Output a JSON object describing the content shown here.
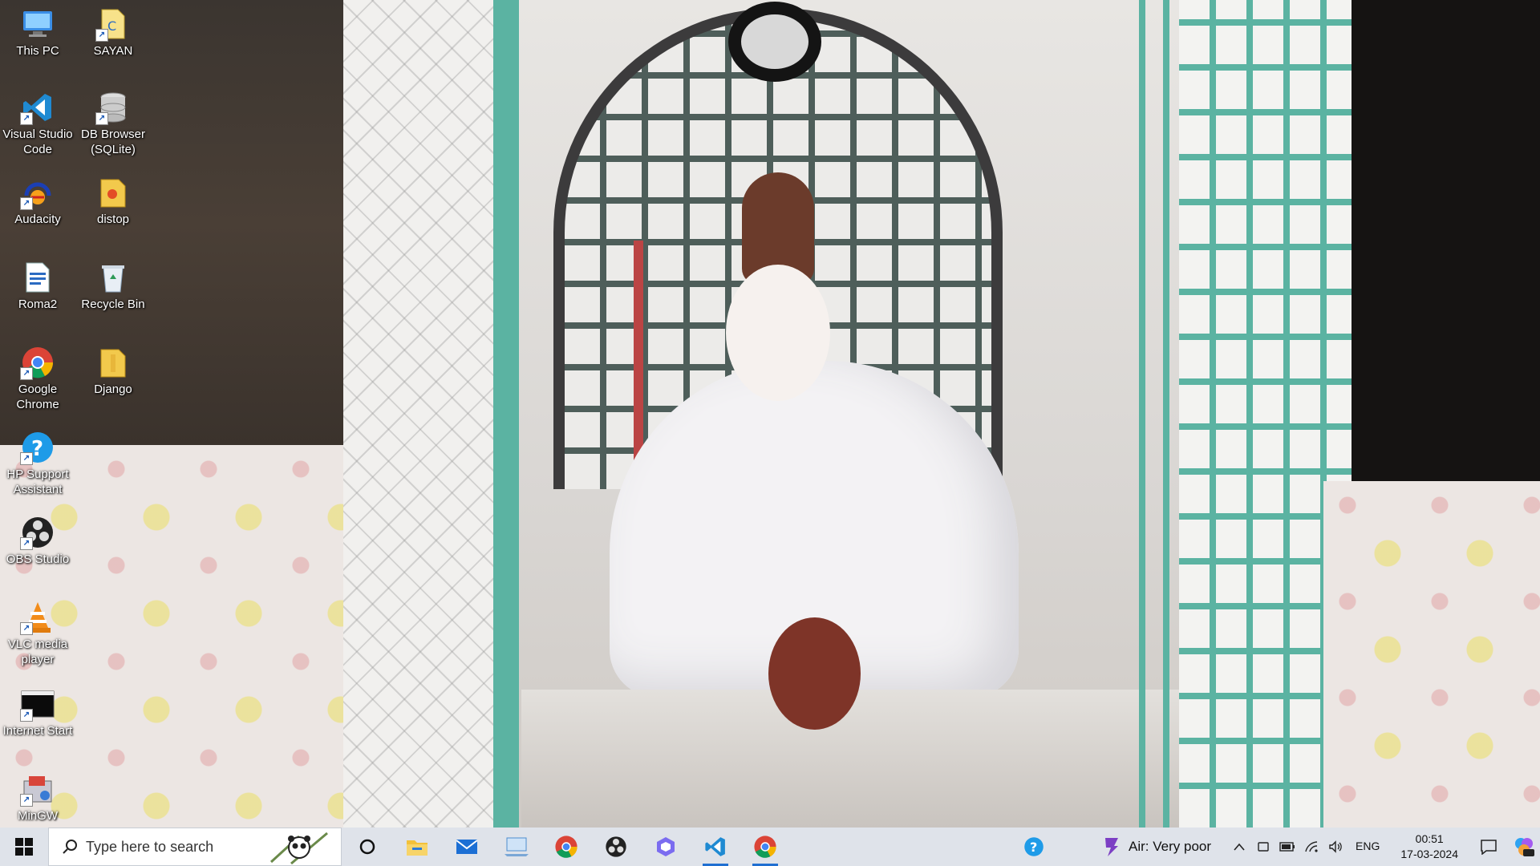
{
  "desktop": {
    "icons": [
      {
        "label": "This PC"
      },
      {
        "label": "SAYAN"
      },
      {
        "label": "Visual Studio Code"
      },
      {
        "label": "DB Browser (SQLite)"
      },
      {
        "label": "Audacity"
      },
      {
        "label": "distop"
      },
      {
        "label": "Roma2"
      },
      {
        "label": "Recycle Bin"
      },
      {
        "label": "Google Chrome"
      },
      {
        "label": "Django"
      },
      {
        "label": "HP Support Assistant"
      },
      {
        "label": "OBS Studio"
      },
      {
        "label": "VLC media player"
      },
      {
        "label": "Internet Start"
      },
      {
        "label": "MinGW"
      }
    ]
  },
  "taskbar": {
    "search_placeholder": "Type here to search",
    "pinned": [
      "start-icon",
      "cortana-icon",
      "file-explorer-icon",
      "mail-icon",
      "desktop-app-icon",
      "chrome-icon",
      "obs-icon",
      "copilot-icon",
      "vscode-icon",
      "chrome-icon"
    ],
    "weather": "Air: Very poor",
    "language": "ENG",
    "time": "00:51",
    "date": "17-03-2024"
  },
  "colors": {
    "taskbar_bg": "#dfe3ea",
    "accent": "#1f6fd1"
  }
}
